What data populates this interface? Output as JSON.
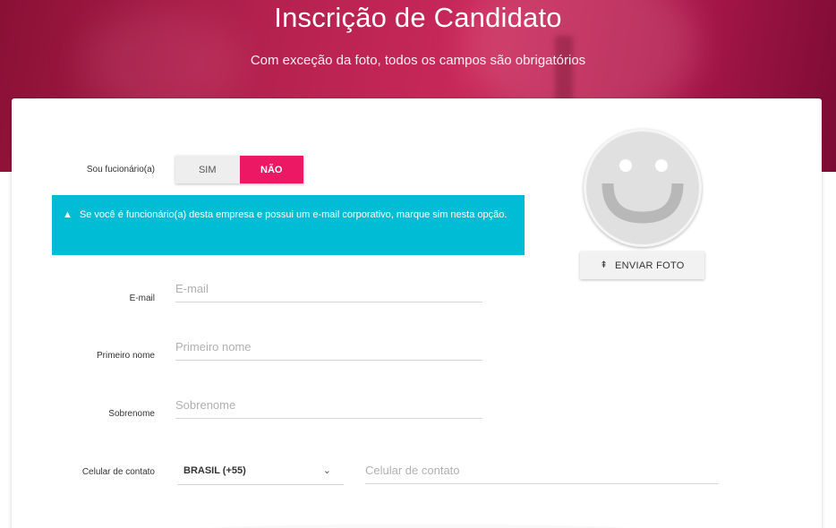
{
  "header": {
    "title": "Inscrição de Candidato",
    "subtitle": "Com exceção da foto, todos os campos são obrigatórios"
  },
  "employee": {
    "label": "Sou fucionário(a)",
    "options": [
      "SIM",
      "NÃO"
    ],
    "selected": "NÃO"
  },
  "alert": {
    "icon": "warning-icon",
    "text": "Se você é funcionário(a) desta empresa e possui um e-mail corporativo, marque sim nesta opção."
  },
  "fields": {
    "email": {
      "label": "E-mail",
      "placeholder": "E-mail",
      "value": ""
    },
    "first_name": {
      "label": "Primeiro nome",
      "placeholder": "Primeiro nome",
      "value": ""
    },
    "last_name": {
      "label": "Sobrenome",
      "placeholder": "Sobrenome",
      "value": ""
    },
    "phone": {
      "label": "Celular de contato",
      "country_value": "BRASIL (+55)",
      "placeholder": "Celular de contato",
      "value": ""
    }
  },
  "photo": {
    "avatar_icon": "smiley-icon",
    "upload_label": "ENVIAR FOTO",
    "upload_icon": "upload-icon"
  },
  "colors": {
    "accent": "#ec1863",
    "alert_bg": "#00bcd4"
  }
}
